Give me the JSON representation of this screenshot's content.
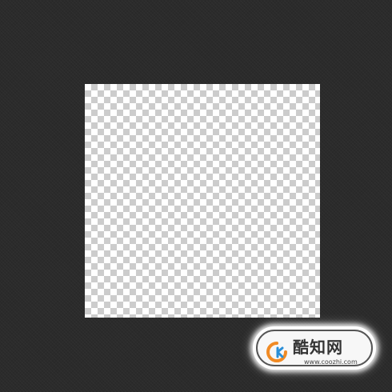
{
  "canvas": {
    "background_color": "#2b2b2b",
    "document": {
      "transparency_pattern": "checkerboard",
      "checker_light": "#ffffff",
      "checker_dark": "#cccccc"
    }
  },
  "watermark": {
    "brand_name": "酷知网",
    "url": "www.coozhi.com",
    "logo_icon": "coozhi-logo-icon",
    "logo_color_orange": "#f08a24",
    "logo_color_blue": "#2a8fd8"
  }
}
